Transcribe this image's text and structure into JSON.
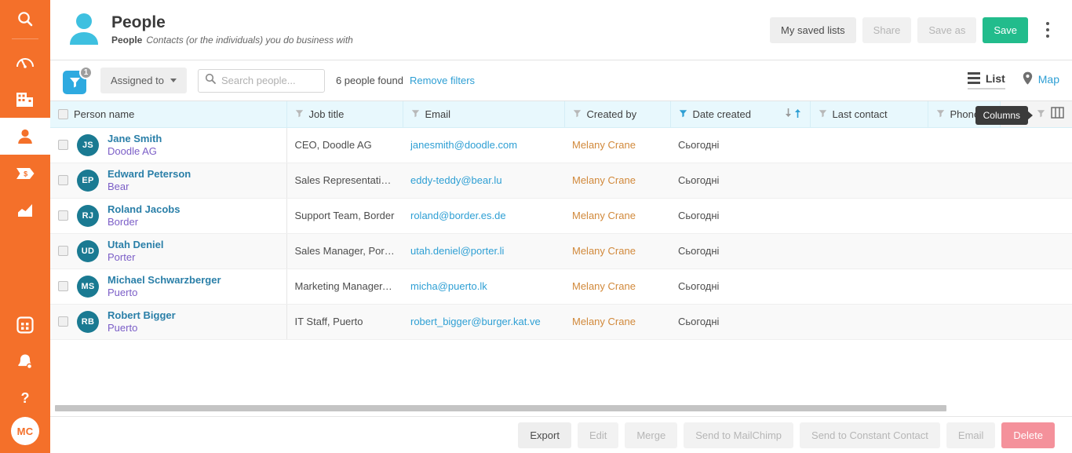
{
  "colors": {
    "sidebar": "#f4702a",
    "accent_blue": "#2e9fd4",
    "avatar_teal": "#1a7a92",
    "save_green": "#22bc8c",
    "delete_pink": "#f4919b",
    "header_cyan": "#e8f8fd",
    "company_purple": "#7b5ec7",
    "creator_orange": "#d1893b"
  },
  "sidebar": {
    "items": [
      {
        "name": "search-icon",
        "label": "Search",
        "active": false
      },
      {
        "name": "dashboard-icon",
        "label": "Dashboard",
        "active": false
      },
      {
        "name": "companies-icon",
        "label": "Companies",
        "active": false
      },
      {
        "name": "people-icon",
        "label": "People",
        "active": true
      },
      {
        "name": "deals-icon",
        "label": "Deals",
        "active": false
      },
      {
        "name": "reports-icon",
        "label": "Reports",
        "active": false
      },
      {
        "name": "apps-icon",
        "label": "Apps",
        "active": false
      },
      {
        "name": "notifications-icon",
        "label": "Notifications",
        "active": false
      },
      {
        "name": "help-icon",
        "label": "Help",
        "active": false
      }
    ],
    "user_avatar_initials": "MC"
  },
  "header": {
    "icon": "person-icon",
    "title": "People",
    "subtitle_bold": "People",
    "subtitle_italic": "Contacts (or the individuals) you do business with",
    "actions": [
      {
        "label": "My saved lists",
        "state": "default"
      },
      {
        "label": "Share",
        "state": "disabled"
      },
      {
        "label": "Save as",
        "state": "disabled"
      },
      {
        "label": "Save",
        "state": "primary"
      }
    ],
    "kebab": "more-options-icon"
  },
  "filterbar": {
    "filter_icon": "filter-funnel-icon",
    "filter_badge": "1",
    "assigned_to_label": "Assigned to",
    "search": {
      "value": "",
      "placeholder": "Search people..."
    },
    "results_text": "6 people found",
    "remove_filters_label": "Remove filters",
    "views": [
      {
        "label": "List",
        "icon": "list-icon",
        "active": true
      },
      {
        "label": "Map",
        "icon": "map-pin-icon",
        "active": false
      }
    ]
  },
  "table": {
    "columns": [
      {
        "label": "Person name",
        "filterable": false,
        "filter_active": false,
        "sortable": false
      },
      {
        "label": "Job title",
        "filterable": true,
        "filter_active": false,
        "sortable": false
      },
      {
        "label": "Email",
        "filterable": true,
        "filter_active": false,
        "sortable": false
      },
      {
        "label": "Created by",
        "filterable": true,
        "filter_active": false,
        "sortable": false
      },
      {
        "label": "Date created",
        "filterable": true,
        "filter_active": true,
        "sortable": true
      },
      {
        "label": "Last contact",
        "filterable": true,
        "filter_active": false,
        "sortable": false
      },
      {
        "label": "Phone",
        "filterable": true,
        "filter_active": false,
        "sortable": false
      }
    ],
    "columns_tooltip": "Columns",
    "columns_button_icon": "columns-icon",
    "rows": [
      {
        "initials": "JS",
        "name": "Jane Smith",
        "company": "Doodle AG",
        "job_title": "CEO, Doodle AG",
        "email": "janesmith@doodle.com",
        "created_by": "Melany Crane",
        "date_created": "Сьогодні",
        "last_contact": "",
        "phone": ""
      },
      {
        "initials": "EP",
        "name": "Edward Peterson",
        "company": "Bear",
        "job_title": "Sales Representative...",
        "email": "eddy-teddy@bear.lu",
        "created_by": "Melany Crane",
        "date_created": "Сьогодні",
        "last_contact": "",
        "phone": ""
      },
      {
        "initials": "RJ",
        "name": "Roland Jacobs",
        "company": "Border",
        "job_title": "Support Team, Border",
        "email": "roland@border.es.de",
        "created_by": "Melany Crane",
        "date_created": "Сьогодні",
        "last_contact": "",
        "phone": ""
      },
      {
        "initials": "UD",
        "name": "Utah Deniel",
        "company": "Porter",
        "job_title": "Sales Manager, Porter",
        "email": "utah.deniel@porter.li",
        "created_by": "Melany Crane",
        "date_created": "Сьогодні",
        "last_contact": "",
        "phone": ""
      },
      {
        "initials": "MS",
        "name": "Michael Schwarzberger",
        "company": "Puerto",
        "job_title": "Marketing Manager, ...",
        "email": "micha@puerto.lk",
        "created_by": "Melany Crane",
        "date_created": "Сьогодні",
        "last_contact": "",
        "phone": ""
      },
      {
        "initials": "RB",
        "name": "Robert Bigger",
        "company": "Puerto",
        "job_title": "IT Staff, Puerto",
        "email": "robert_bigger@burger.kat.ve",
        "created_by": "Melany Crane",
        "date_created": "Сьогодні",
        "last_contact": "",
        "phone": ""
      }
    ]
  },
  "footer": {
    "buttons": [
      {
        "label": "Export",
        "state": "default"
      },
      {
        "label": "Edit",
        "state": "disabled"
      },
      {
        "label": "Merge",
        "state": "disabled"
      },
      {
        "label": "Send to MailChimp",
        "state": "disabled"
      },
      {
        "label": "Send to Constant Contact",
        "state": "disabled"
      },
      {
        "label": "Email",
        "state": "disabled"
      },
      {
        "label": "Delete",
        "state": "danger"
      }
    ]
  }
}
